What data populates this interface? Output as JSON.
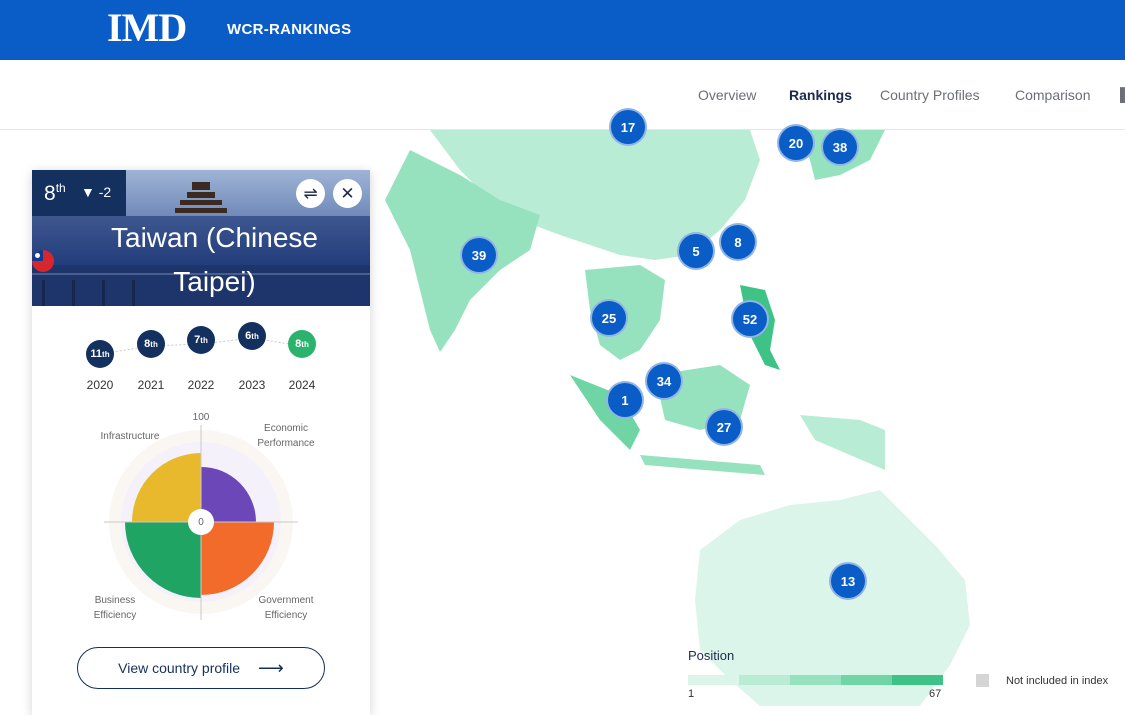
{
  "header": {
    "logo_text": "IMD",
    "brand": "WCR-RANKINGS",
    "colors": {
      "brand_blue": "#0a5cc6",
      "navy": "#14305f"
    }
  },
  "nav": {
    "items": [
      {
        "label": "Overview",
        "active": false
      },
      {
        "label": "Rankings",
        "active": true
      },
      {
        "label": "Country Profiles",
        "active": false
      },
      {
        "label": "Comparison",
        "active": false
      }
    ]
  },
  "map": {
    "clusters": [
      "17",
      "20",
      "38",
      "39",
      "5",
      "8",
      "25",
      "52",
      "34",
      "1",
      "27",
      "13"
    ],
    "legend": {
      "title": "Position",
      "min": "1",
      "max": "67",
      "not_included": "Not included in index",
      "scale_colors": [
        "#dcf5ea",
        "#b9ecd4",
        "#96e2bf",
        "#6fd5a5",
        "#3fc285"
      ]
    }
  },
  "country_card": {
    "rank": "8",
    "rank_suffix": "th",
    "rank_change": "▼ -2",
    "country_name": "Taiwan (Chinese Taipei)",
    "swap_icon": "swap-icon",
    "close_icon": "close-icon",
    "timeline": [
      {
        "year": "2020",
        "rank": "11",
        "suffix": "th"
      },
      {
        "year": "2021",
        "rank": "8",
        "suffix": "th"
      },
      {
        "year": "2022",
        "rank": "7",
        "suffix": "th"
      },
      {
        "year": "2023",
        "rank": "6",
        "suffix": "th"
      },
      {
        "year": "2024",
        "rank": "8",
        "suffix": "th"
      }
    ],
    "radar": {
      "max_label": "100",
      "center_label": "0",
      "factors": [
        {
          "name": "Infrastructure",
          "color": "#e8b92d"
        },
        {
          "name": "Economic Performance",
          "color": "#6b47b8"
        },
        {
          "name": "Business Efficiency",
          "color": "#1fa463"
        },
        {
          "name": "Government Efficiency",
          "color": "#f26b2b"
        }
      ]
    },
    "view_profile_label": "View country profile"
  }
}
